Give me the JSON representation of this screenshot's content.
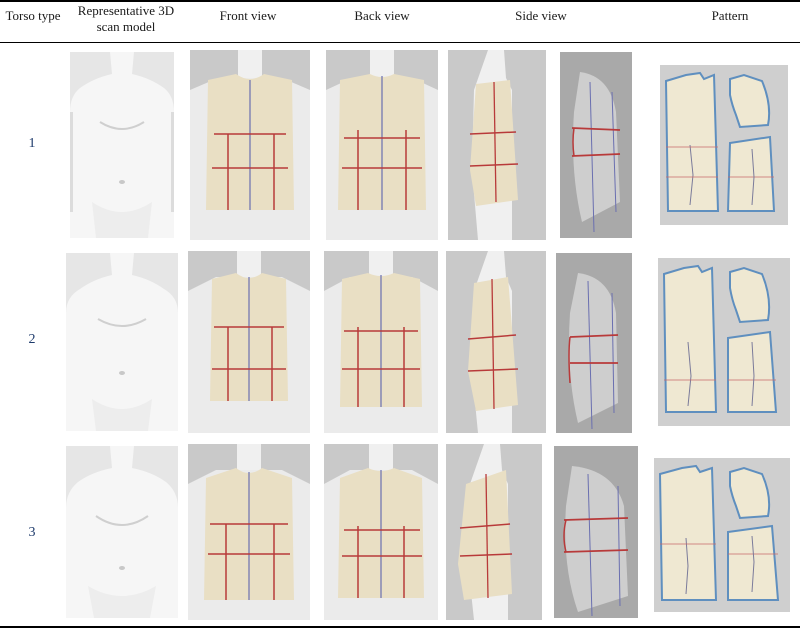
{
  "headers": {
    "torso_type": "Torso type",
    "scan_model_line1": "Representative 3D",
    "scan_model_line2": "scan model",
    "front_view": "Front view",
    "back_view": "Back view",
    "side_view": "Side view",
    "pattern": "Pattern"
  },
  "rows": [
    {
      "label": "1"
    },
    {
      "label": "2"
    },
    {
      "label": "3"
    }
  ],
  "colors": {
    "garment": "#e9dfc4",
    "panel_bg": "#c9c9c9",
    "body": "#f2f2f2",
    "red_line": "#b83a3a",
    "blue_line": "#6a6fb0",
    "pattern_bg": "#cfcfcf",
    "pattern_fill": "#efe8d2",
    "pattern_edge": "#5f8fbf"
  }
}
